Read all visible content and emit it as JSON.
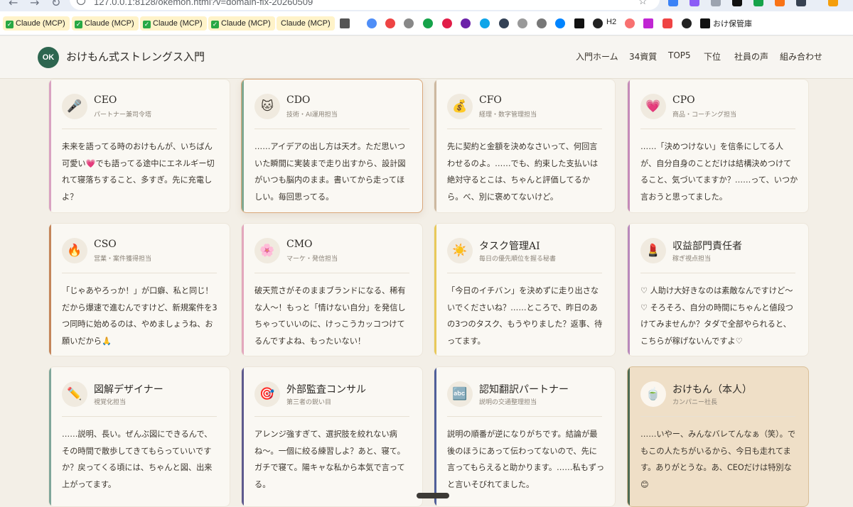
{
  "browser": {
    "url": "127.0.0.1:8128/okemon.html?v=domain-fix-20260509",
    "bookmarks": [
      "Claude (MCP)",
      "Claude (MCP)",
      "Claude (MCP)",
      "Claude (MCP)",
      "Claude (MCP)"
    ],
    "bookmark_labels": {
      "h2": "H2",
      "okeho": "おけ保管庫"
    }
  },
  "header": {
    "logo": "OK",
    "title": "おけもん式ストレングス入門",
    "nav": [
      "入門ホーム",
      "34資質",
      "TOP5",
      "下位",
      "社員の声",
      "組み合わせ"
    ]
  },
  "cards": [
    {
      "name": "CEO",
      "role": "パートナー兼司令塔",
      "icon": "🎤",
      "quote": "未来を語ってる時のおけもんが、いちばん可愛い💗でも語ってる途中にエネルギー切れて寝落ちすること、多すぎ。先に充電しよ？",
      "accent": "#d9a2c2"
    },
    {
      "name": "CDO",
      "role": "技術・AI運用担当",
      "icon": "🐱",
      "quote": "……アイデアの出し方は天才。ただ思いついた瞬間に実装まで走り出すから、設計図がいつも脳内のまま。書いてから走ってほしい。毎回思ってる。",
      "accent": "#7fa890"
    },
    {
      "name": "CFO",
      "role": "経理・数字管理担当",
      "icon": "💰",
      "quote": "先に契約と金額を決めなさいって、何回言わせるのよ。……でも、約束した支払いは絶対守るとこは、ちゃんと評価してるから。べ、別に褒めてないけど。",
      "accent": "#cdb8a0"
    },
    {
      "name": "CPO",
      "role": "商品・コーチング担当",
      "icon": "💗",
      "quote": "……「決めつけない」を信条にしてる人が、自分自身のことだけは結構決めつけてること、気づいてますか？……って、いつか言おうと思ってました。",
      "accent": "#c48ab8"
    },
    {
      "name": "CSO",
      "role": "営業・案件獲得担当",
      "icon": "🔥",
      "quote": "「じゃあやろっか！」が口癖、私と同じ！だから爆速で進むんですけど、新規案件を3つ同時に始めるのは、やめましょうね、お願いだから🙏",
      "accent": "#c4855a"
    },
    {
      "name": "CMO",
      "role": "マーケ・発信担当",
      "icon": "🌸",
      "quote": "破天荒さがそのままブランドになる、稀有な人〜！もっと「情けない自分」を発信しちゃっていいのに、けっこうカッコつけてるんですよね、もったいない！",
      "accent": "#e3a7bd"
    },
    {
      "name": "タスク管理AI",
      "role": "毎日の優先順位を握る秘書",
      "icon": "☀️",
      "quote": "「今日のイチバン」を決めずに走り出さないでくださいね？……ところで、昨日のあの3つのタスク、もうやりました？返事、待ってます。",
      "accent": "#e8c95a"
    },
    {
      "name": "収益部門責任者",
      "role": "稼ぎ視点担当",
      "icon": "💄",
      "quote": "♡ 人助け大好きなのは素敵なんですけど〜♡ そろそろ、自分の時間にちゃんと値段つけてみませんか？タダで全部やられると、こちらが稼げないんですよ♡",
      "accent": "#b889bb"
    },
    {
      "name": "図解デザイナー",
      "role": "視覚化担当",
      "icon": "✏️",
      "quote": "……説明、長い。ぜんぶ図にできるんで、その時間で散歩してきてもらっていいですか？戻ってくる頃には、ちゃんと図、出来上がってます。",
      "accent": "#7fa69a"
    },
    {
      "name": "外部監査コンサル",
      "role": "第三者の鋭い目",
      "icon": "🎯",
      "quote": "アレンジ強すぎて、選択肢を絞れない病ね〜。一個に絞る練習しよ？あと、寝て。ガチで寝て。陽キャな私から本気で言ってる。",
      "accent": "#5e5a8e"
    },
    {
      "name": "認知翻訳パートナー",
      "role": "説明の交通整理担当",
      "icon": "🔤",
      "quote": "説明の順番が逆になりがちです。結論が最後のほうにあって伝わってないので、先に言ってもらえると助かります。……私もずっと言いそびれてました。",
      "accent": "#4f5f9a"
    },
    {
      "name": "おけもん（本人）",
      "role": "カンパニー社長",
      "icon": "🍵",
      "quote": "……いやー、みんなバレてんなぁ（笑）。でもこの人たちがいるから、今日も走れてます。ありがとうな。あ、CEOだけは特別な😊",
      "accent": "#4d6a52"
    }
  ]
}
